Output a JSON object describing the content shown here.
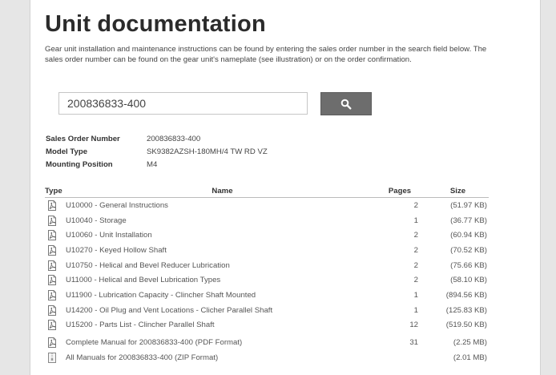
{
  "header": {
    "title": "Unit documentation",
    "intro": "Gear unit installation and maintenance instructions can be found by entering the sales order number in the search field below. The sales order number can be found on the gear unit's nameplate (see illustration) or on the order confirmation."
  },
  "search": {
    "value": "200836833-400",
    "button_icon": "search-icon"
  },
  "order_info": [
    {
      "label": "Sales Order Number",
      "value": "200836833-400"
    },
    {
      "label": "Model Type",
      "value": "SK9382AZSH-180MH/4 TW RD VZ"
    },
    {
      "label": "Mounting Position",
      "value": "M4"
    }
  ],
  "table": {
    "headers": {
      "type": "Type",
      "name": "Name",
      "pages": "Pages",
      "size": "Size"
    },
    "rows": [
      {
        "icon": "pdf-icon",
        "name": "U10000 - General Instructions",
        "pages": "2",
        "size": "(51.97 KB)"
      },
      {
        "icon": "pdf-icon",
        "name": "U10040 - Storage",
        "pages": "1",
        "size": "(36.77 KB)"
      },
      {
        "icon": "pdf-icon",
        "name": "U10060 - Unit Installation",
        "pages": "2",
        "size": "(60.94 KB)"
      },
      {
        "icon": "pdf-icon",
        "name": "U10270 - Keyed Hollow Shaft",
        "pages": "2",
        "size": "(70.52 KB)"
      },
      {
        "icon": "pdf-icon",
        "name": "U10750 - Helical and Bevel Reducer Lubrication",
        "pages": "2",
        "size": "(75.66 KB)"
      },
      {
        "icon": "pdf-icon",
        "name": "U11000 - Helical and Bevel Lubrication Types",
        "pages": "2",
        "size": "(58.10 KB)"
      },
      {
        "icon": "pdf-icon",
        "name": "U11900 - Lubrication Capacity - Clincher Shaft Mounted",
        "pages": "1",
        "size": "(894.56 KB)"
      },
      {
        "icon": "pdf-icon",
        "name": "U14200 - Oil Plug and Vent Locations - Clicher Parallel Shaft",
        "pages": "1",
        "size": "(125.83 KB)"
      },
      {
        "icon": "pdf-icon",
        "name": "U15200 - Parts List - Clincher Parallel Shaft",
        "pages": "12",
        "size": "(519.50 KB)"
      },
      {
        "icon": "pdf-icon",
        "name": "Complete Manual for 200836833-400 (PDF Format)",
        "pages": "31",
        "size": "(2.25 MB)"
      },
      {
        "icon": "zip-icon",
        "name": "All Manuals for 200836833-400 (ZIP Format)",
        "pages": "",
        "size": "(2.01 MB)"
      }
    ]
  },
  "colors": {
    "background": "#e6e6e6",
    "title": "#2b2b2b",
    "search_button": "#6d6d6d"
  }
}
